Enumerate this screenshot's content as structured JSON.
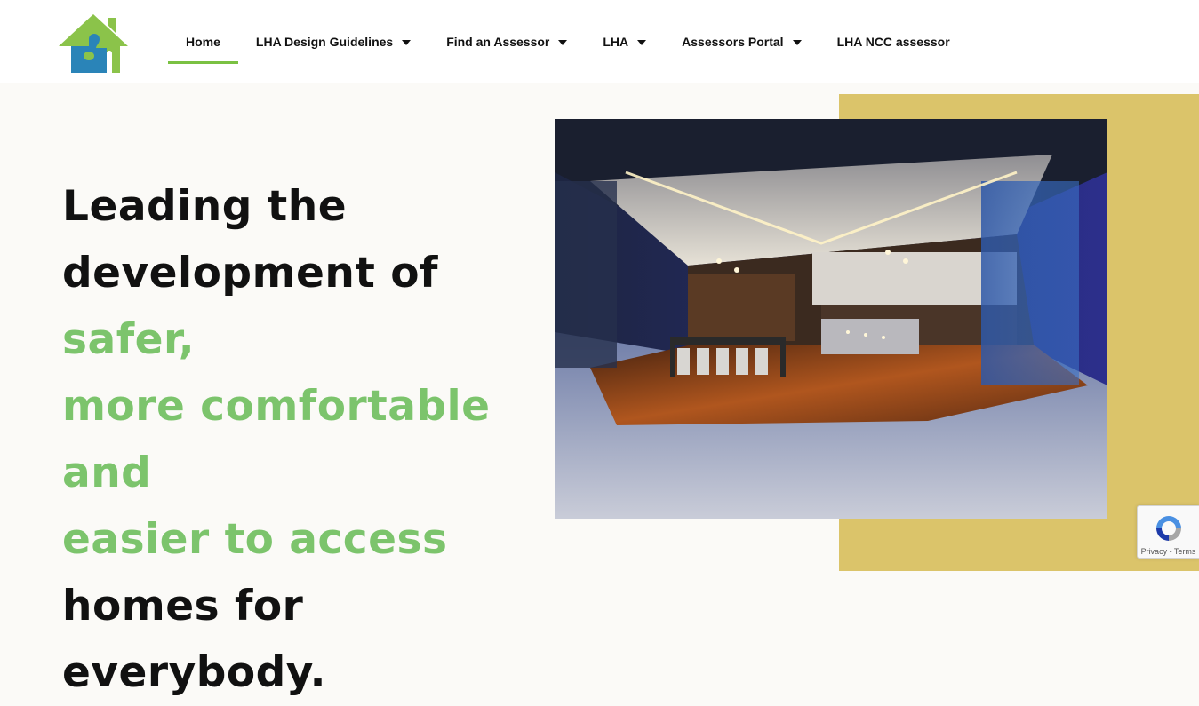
{
  "header": {
    "logo_icon": "house-puzzle-logo-icon",
    "nav": {
      "items": [
        {
          "label": "Home",
          "active": true,
          "has_dropdown": false
        },
        {
          "label": "LHA Design Guidelines",
          "active": false,
          "has_dropdown": true
        },
        {
          "label": "Find an Assessor",
          "active": false,
          "has_dropdown": true
        },
        {
          "label": "LHA",
          "active": false,
          "has_dropdown": true
        },
        {
          "label": "Assessors Portal",
          "active": false,
          "has_dropdown": true
        },
        {
          "label": "LHA NCC assessor",
          "active": false,
          "has_dropdown": false
        }
      ]
    }
  },
  "hero": {
    "headline": {
      "part1": "Leading the",
      "part2": "development of ",
      "highlight1": "safer,",
      "highlight2": "more comfortable and",
      "highlight3": "easier to access",
      "part3": "homes for everybody."
    },
    "image": {
      "subject": "modern-kitchen-dining-night-photo"
    }
  },
  "recaptcha": {
    "icon": "recaptcha-icon",
    "privacy": "Privacy",
    "separator": " - ",
    "terms": "Terms"
  },
  "colors": {
    "accent_green": "#7cc46c",
    "nav_underline": "#7ac142",
    "block_yellow": "#dbc46a",
    "background": "#fbfaf7",
    "logo_green": "#8bc34a",
    "logo_blue": "#2a84b8"
  }
}
